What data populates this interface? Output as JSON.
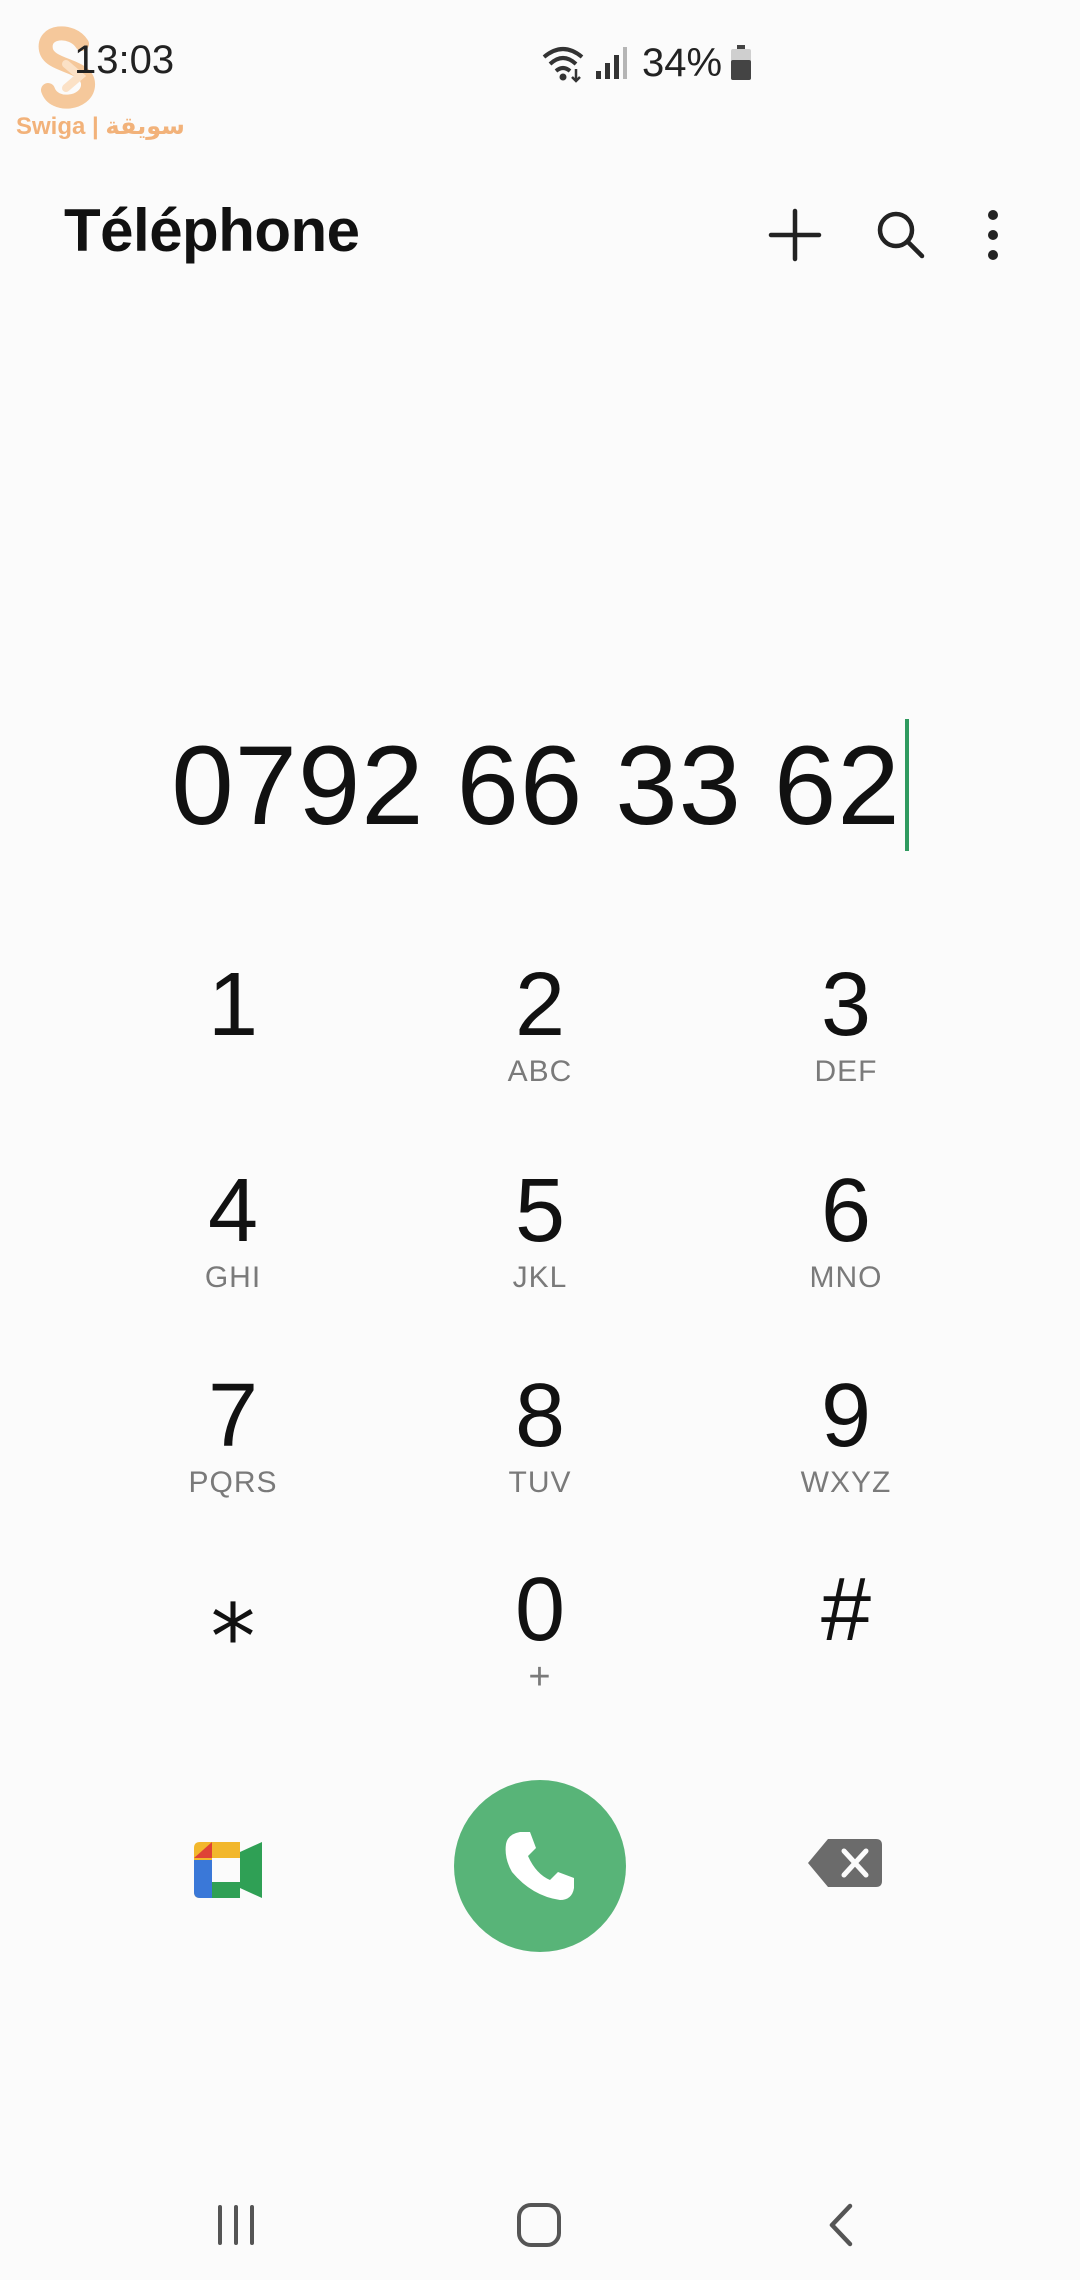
{
  "status_bar": {
    "time": "13:03",
    "battery_percent": "34%",
    "watermark_text": "Swiga | سويقة"
  },
  "app_bar": {
    "title": "Téléphone",
    "icons": [
      "plus-icon",
      "search-icon",
      "more-vert-icon"
    ]
  },
  "dialer": {
    "number": "0792 66 33 62",
    "cursor_color": "#2f9a5f"
  },
  "keypad": {
    "keys": [
      {
        "digit": "1",
        "letters": ""
      },
      {
        "digit": "2",
        "letters": "ABC"
      },
      {
        "digit": "3",
        "letters": "DEF"
      },
      {
        "digit": "4",
        "letters": "GHI"
      },
      {
        "digit": "5",
        "letters": "JKL"
      },
      {
        "digit": "6",
        "letters": "MNO"
      },
      {
        "digit": "7",
        "letters": "PQRS"
      },
      {
        "digit": "8",
        "letters": "TUV"
      },
      {
        "digit": "9",
        "letters": "WXYZ"
      },
      {
        "digit": "⁎",
        "letters": ""
      },
      {
        "digit": "0",
        "letters": "+"
      },
      {
        "digit": "#",
        "letters": ""
      }
    ]
  },
  "actions": {
    "call_color": "#58b478",
    "icons": [
      "google-meet-icon",
      "phone-icon",
      "backspace-icon"
    ]
  },
  "nav_bar": {
    "icons": [
      "recents-icon",
      "home-icon",
      "back-icon"
    ]
  }
}
